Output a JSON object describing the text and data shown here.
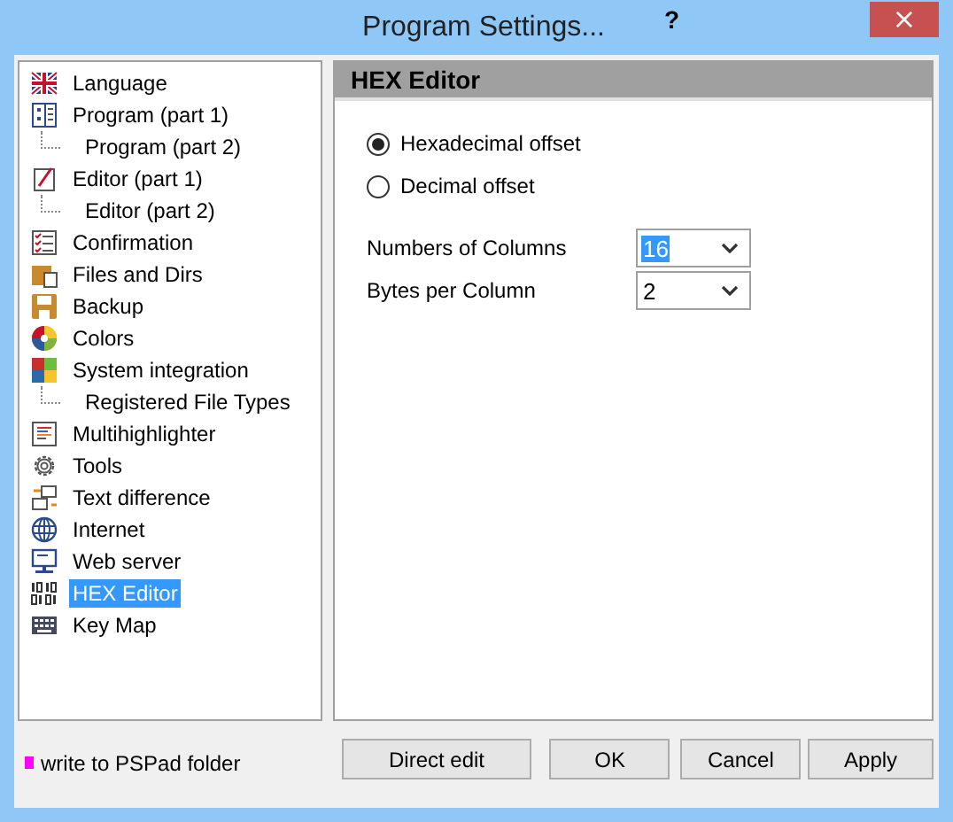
{
  "window": {
    "title": "Program Settings..."
  },
  "title_buttons": {
    "help": "?",
    "close": "×"
  },
  "tree": [
    {
      "label": "Language",
      "selected": false
    },
    {
      "label": "Program  (part 1)",
      "selected": false,
      "children": [
        {
          "label": "Program  (part 2)",
          "selected": false
        }
      ]
    },
    {
      "label": "Editor  (part 1)",
      "selected": false,
      "children": [
        {
          "label": "Editor  (part 2)",
          "selected": false
        }
      ]
    },
    {
      "label": "Confirmation",
      "selected": false
    },
    {
      "label": "Files and Dirs",
      "selected": false
    },
    {
      "label": "Backup",
      "selected": false
    },
    {
      "label": "Colors",
      "selected": false
    },
    {
      "label": "System integration",
      "selected": false,
      "children": [
        {
          "label": "Registered File Types",
          "selected": false
        }
      ]
    },
    {
      "label": "Multihighlighter",
      "selected": false
    },
    {
      "label": "Tools",
      "selected": false
    },
    {
      "label": "Text difference",
      "selected": false
    },
    {
      "label": "Internet",
      "selected": false
    },
    {
      "label": "Web server",
      "selected": false
    },
    {
      "label": "HEX Editor",
      "selected": true
    },
    {
      "label": "Key Map",
      "selected": false
    }
  ],
  "panel": {
    "title": "HEX Editor",
    "radios": [
      {
        "label": "Hexadecimal offset",
        "selected": true
      },
      {
        "label": "Decimal offset",
        "selected": false
      }
    ],
    "fields": [
      {
        "label": "Numbers of Columns",
        "value": "16",
        "focused": true
      },
      {
        "label": "Bytes per Column",
        "value": "2",
        "focused": false
      }
    ]
  },
  "legend": {
    "text": "write to PSPad folder",
    "color": "#ff00ff"
  },
  "buttons": [
    "Direct edit",
    "OK",
    "Cancel",
    "Apply"
  ]
}
